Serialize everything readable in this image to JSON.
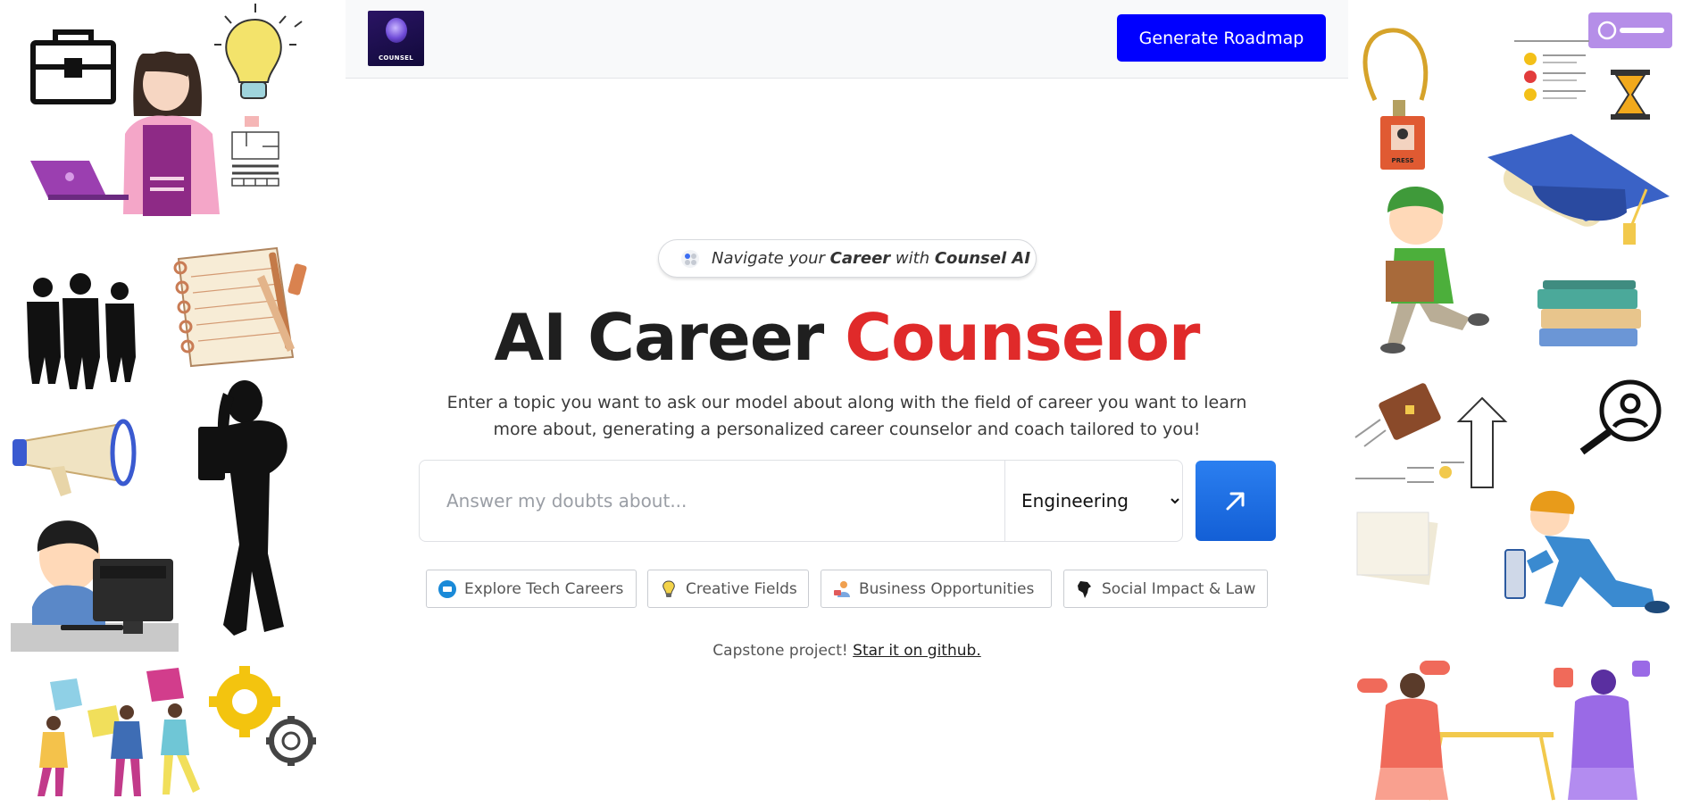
{
  "header": {
    "logo_text": "COUNSEL",
    "generate_button": "Generate Roadmap"
  },
  "badge": {
    "part1": "Navigate your ",
    "part2": "Career",
    "part3": " with ",
    "part4": "Counsel AI"
  },
  "hero": {
    "title_main": "AI Career ",
    "title_accent": "Counselor",
    "description": "Enter a topic you want to ask our model about along with the field of career you want to learn more about, generating a personalized career counselor and coach tailored to you!"
  },
  "search": {
    "placeholder": "Answer my doubts about...",
    "value": ""
  },
  "field_select": {
    "selected": "Engineering"
  },
  "chips": [
    {
      "label": "Explore Tech Careers",
      "icon": "chip-icon-tech"
    },
    {
      "label": "Creative Fields",
      "icon": "lightbulb-icon"
    },
    {
      "label": "Business Opportunities",
      "icon": "business-person-icon"
    },
    {
      "label": "Social Impact & Law",
      "icon": "india-map-icon"
    }
  ],
  "footer": {
    "text": "Capstone project! ",
    "link": "Star it on github."
  },
  "illustrations": {
    "left": [
      "briefcase-icon",
      "lightbulb-icon",
      "woman-with-laptop-illustration",
      "business-people-silhouette",
      "notebook-and-pens-illustration",
      "megaphone-icon",
      "woman-silhouette",
      "boy-at-computer-illustration",
      "puzzle-team-illustration",
      "gears-icon"
    ],
    "right": [
      "press-badge-icon",
      "checklist-icon",
      "hourglass-icon",
      "graduation-cap-icon",
      "delivery-man-illustration",
      "books-stack-icon",
      "career-growth-illustration",
      "search-person-icon",
      "papers-stack-icon",
      "electrician-illustration",
      "interview-illustration"
    ],
    "press_label": "PRESS"
  },
  "colors": {
    "primary_blue": "#0000ff",
    "accent_red": "#e02a2a",
    "go_button": "#1a6ee6"
  }
}
